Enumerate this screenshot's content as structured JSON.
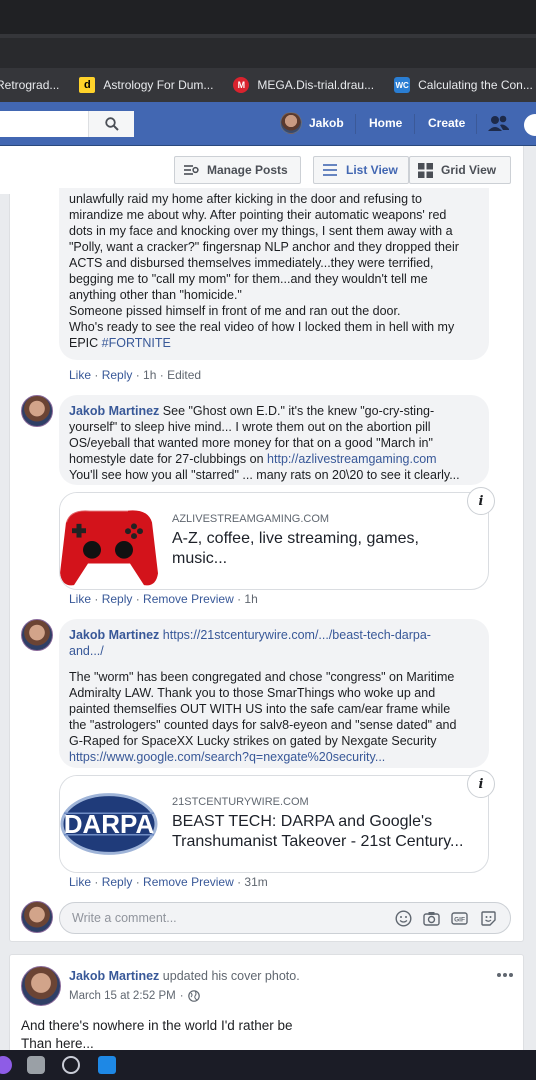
{
  "bookmarks": [
    {
      "label": "Retrograd...",
      "icon": "none"
    },
    {
      "label": "Astrology For Dum...",
      "icon": "d"
    },
    {
      "label": "MEGA.Dis-trial.drau...",
      "icon": "M"
    },
    {
      "label": "Calculating the Con...",
      "icon": "WC"
    }
  ],
  "header": {
    "user_name": "Jakob",
    "home": "Home",
    "create": "Create"
  },
  "toolbar": {
    "manage_posts": "Manage Posts",
    "list_view": "List View",
    "grid_view": "Grid View"
  },
  "comment1": {
    "lines": [
      "unlawfully raid my home after kicking in the door and refusing to",
      "mirandize me about why. After pointing their automatic weapons' red",
      "dots in my face and knocking over my things, I sent them away with a",
      "\"Polly, want a cracker?\" fingersnap NLP anchor and they dropped their",
      "ACTS and disbursed themselves immediately...they were terrified,",
      "begging me to \"call my mom\" for them...and they wouldn't tell me",
      "anything other than \"homicide.\"",
      "Someone pissed himself in front of me and ran out the door.",
      "Who's ready to see the real video of how I locked them in hell with my"
    ],
    "last_line_text": "EPIC ",
    "hashtag": "#FORTNITE",
    "like": "Like",
    "reply": "Reply",
    "time": "1h",
    "edited": "Edited"
  },
  "comment2": {
    "author": "Jakob Martinez",
    "line1": " See \"Ghost own E.D.\" it's the knew \"go-cry-sting-",
    "line2": "yourself\" to sleep hive mind... I wrote them out on the abortion pill",
    "line3": "OS/eyeball that wanted more money for that on a good \"March in\"",
    "line4": "homestyle date for 27-clubbings on ",
    "link": "http://azlivestreamgaming.com",
    "line5": "You'll see how you all \"starred\" ... many rats on 20\\20 to see it clearly...",
    "preview_domain": "AZLIVESTREAMGAMING.COM",
    "preview_title_1": "A-Z, coffee, live streaming, games,",
    "preview_title_2": "music...",
    "like": "Like",
    "reply": "Reply",
    "remove_preview": "Remove Preview",
    "time": "1h"
  },
  "comment3": {
    "author": "Jakob Martinez",
    "url_1": "https://21stcenturywire.com/.../beast-tech-darpa-",
    "url_2": "and.../",
    "lines": [
      "The \"worm\" has been congregated and chose \"congress\" on Maritime",
      "Admiralty LAW. Thank you to those SmarThings who woke up and",
      "painted themselfies OUT WITH US into the safe cam/ear frame while",
      "the \"astrologers\" counted days for salv8-eyeon and \"sense dated\" and",
      "G-Raped for SpaceXX Lucky strikes on gated by Nexgate Security"
    ],
    "link": "https://www.google.com/search?q=nexgate%20security...",
    "preview_image_text": "DARPA",
    "preview_domain": "21STCENTURYWIRE.COM",
    "preview_title_1": "BEAST TECH: DARPA and Google's",
    "preview_title_2": "Transhumanist Takeover - 21st Century...",
    "like": "Like",
    "reply": "Reply",
    "remove_preview": "Remove Preview",
    "time": "31m"
  },
  "comment_box": {
    "placeholder": "Write a comment..."
  },
  "post2": {
    "author": "Jakob Martinez",
    "action": " updated his cover photo.",
    "date": "March 15 at 2:52 PM",
    "text_1": "And there's nowhere in the world I'd rather be",
    "text_2": "Than here..."
  },
  "colors": {
    "fb_blue": "#4267b2",
    "link_blue": "#385898",
    "bubble_bg": "#f2f3f5"
  }
}
